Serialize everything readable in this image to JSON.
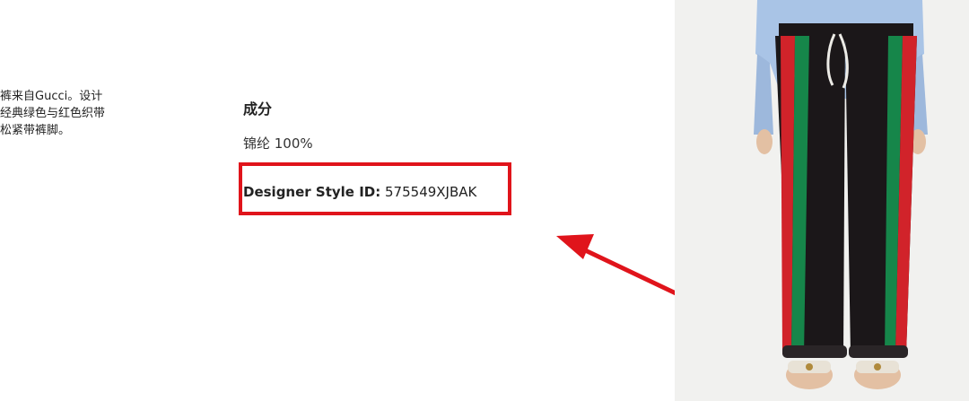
{
  "description": {
    "lines": [
      "裤来自Gucci。设计",
      "经典绿色与红色织带",
      "松紧带裤脚。"
    ]
  },
  "composition": {
    "heading": "成分",
    "value": "锦纶 100%"
  },
  "style_id": {
    "label": "Designer Style ID:",
    "value": "575549XJBAK"
  },
  "annotation": {
    "box_color": "#e0141b",
    "arrow_color": "#e0141b"
  },
  "product_image": {
    "alt": "product-photo-track-pants",
    "colors": {
      "pants": "#1b1719",
      "stripe_green": "#16864a",
      "stripe_red": "#d1232a",
      "shirt": "#a9c4e6",
      "background": "#f1f1ef"
    }
  }
}
